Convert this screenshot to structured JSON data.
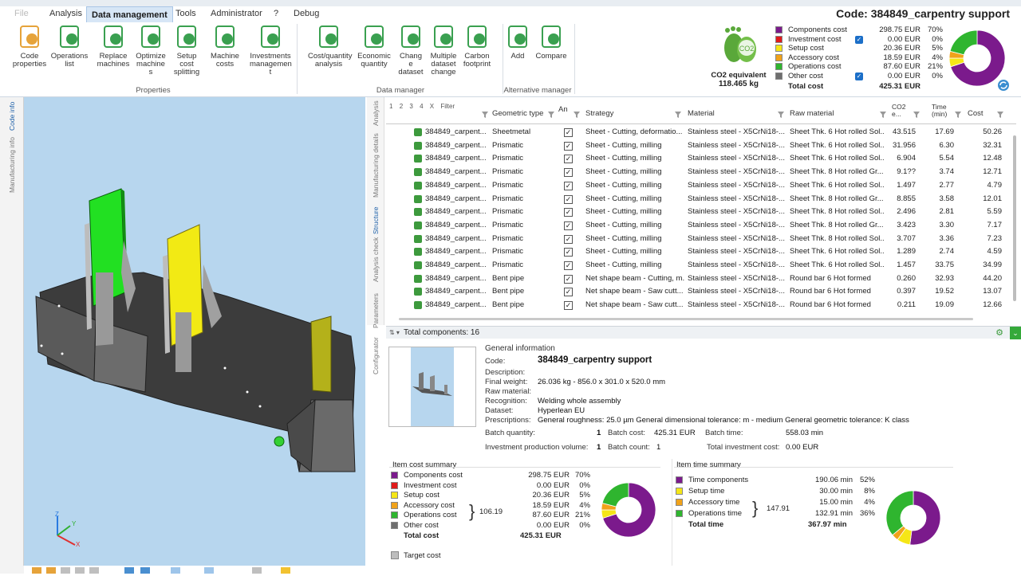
{
  "window": {
    "title": "Code: 384849_carpentry support",
    "file_tab": "File"
  },
  "menu": [
    "Analysis",
    "Data management",
    "Tools",
    "Administrator",
    "?",
    "Debug"
  ],
  "ribbon": {
    "buttons": [
      {
        "label": "Code\nproperties",
        "icon": "code-properties-icon"
      },
      {
        "label": "Operations\nlist",
        "icon": "operations-list-icon"
      },
      {
        "label": "Replace\nmachines",
        "icon": "replace-machines-icon"
      },
      {
        "label": "Optimize\nmachine\ns",
        "icon": "optimize-machines-icon"
      },
      {
        "label": "Setup\ncost\nsplitting",
        "icon": "setup-cost-icon"
      },
      {
        "label": "Machine\ncosts",
        "icon": "machine-costs-icon"
      },
      {
        "label": "Investments\nmanagemen\nt",
        "icon": "investments-icon"
      },
      {
        "label": "Cost/quantity\nanalysis",
        "icon": "cost-quantity-icon"
      },
      {
        "label": "Economic\nquantity",
        "icon": "economic-quantity-icon"
      },
      {
        "label": "Chang\ne\ndataset",
        "icon": "change-dataset-icon"
      },
      {
        "label": "Multiple\ndataset\nchange",
        "icon": "multiple-dataset-icon"
      },
      {
        "label": "Carbon\nfootprint",
        "icon": "carbon-footprint-icon"
      },
      {
        "label": "Add",
        "icon": "add-icon"
      },
      {
        "label": "Compare",
        "icon": "compare-icon"
      }
    ],
    "groups": [
      "Properties",
      "Data manager",
      "Alternative manager"
    ]
  },
  "co2": {
    "label": "CO2 equivalent",
    "value": "118.465 kg"
  },
  "cost_legend": [
    {
      "name": "Components cost",
      "value": "298.75 EUR",
      "pct": "70%",
      "color": "#7b1a8c",
      "checked": false
    },
    {
      "name": "Investment cost",
      "value": "0.00 EUR",
      "pct": "0%",
      "color": "#e01b1b",
      "checked": true
    },
    {
      "name": "Setup cost",
      "value": "20.36 EUR",
      "pct": "5%",
      "color": "#f5e617",
      "checked": false
    },
    {
      "name": "Accessory cost",
      "value": "18.59 EUR",
      "pct": "4%",
      "color": "#f0a21a",
      "checked": false
    },
    {
      "name": "Operations cost",
      "value": "87.60 EUR",
      "pct": "21%",
      "color": "#2fb52f",
      "checked": false
    },
    {
      "name": "Other cost",
      "value": "0.00 EUR",
      "pct": "0%",
      "color": "#6e6e6e",
      "checked": true
    }
  ],
  "total_cost": {
    "label": "Total cost",
    "value": "425.31 EUR"
  },
  "side_tabs": [
    "Code info",
    "Manufacturing info"
  ],
  "mid_tabs": [
    "Analysis",
    "Manufacturing details",
    "Structure",
    "Analysis check",
    "Parameters",
    "Configurator"
  ],
  "grid": {
    "filter_label": "Filter",
    "level_buttons": [
      "1",
      "2",
      "3",
      "4",
      "X"
    ],
    "columns": [
      "Geometric type",
      "An",
      "Strategy",
      "Material",
      "Raw material",
      "CO2\ne...",
      "Time\n(min)",
      "Cost"
    ],
    "rows": [
      [
        "384849_carpent...",
        "Sheetmetal",
        "Sheet - Cutting, deformatio...",
        "Stainless steel - X5CrNi18-...",
        "Sheet Thk. 6 Hot rolled Sol...",
        "43.515",
        "17.69",
        "50.26"
      ],
      [
        "384849_carpent...",
        "Prismatic",
        "Sheet - Cutting, milling",
        "Stainless steel - X5CrNi18-...",
        "Sheet Thk. 6 Hot rolled Sol...",
        "31.956",
        "6.30",
        "32.31"
      ],
      [
        "384849_carpent...",
        "Prismatic",
        "Sheet - Cutting, milling",
        "Stainless steel - X5CrNi18-...",
        "Sheet Thk. 6 Hot rolled Sol...",
        "6.904",
        "5.54",
        "12.48"
      ],
      [
        "384849_carpent...",
        "Prismatic",
        "Sheet - Cutting, milling",
        "Stainless steel - X5CrNi18-...",
        "Sheet Thk. 8 Hot rolled Gr...",
        "9.1??",
        "3.74",
        "12.71"
      ],
      [
        "384849_carpent...",
        "Prismatic",
        "Sheet - Cutting, milling",
        "Stainless steel - X5CrNi18-...",
        "Sheet Thk. 6 Hot rolled Sol...",
        "1.497",
        "2.77",
        "4.79"
      ],
      [
        "384849_carpent...",
        "Prismatic",
        "Sheet - Cutting, milling",
        "Stainless steel - X5CrNi18-...",
        "Sheet Thk. 8 Hot rolled Gr...",
        "8.855",
        "3.58",
        "12.01"
      ],
      [
        "384849_carpent...",
        "Prismatic",
        "Sheet - Cutting, milling",
        "Stainless steel - X5CrNi18-...",
        "Sheet Thk. 8 Hot rolled Sol...",
        "2.496",
        "2.81",
        "5.59"
      ],
      [
        "384849_carpent...",
        "Prismatic",
        "Sheet - Cutting, milling",
        "Stainless steel - X5CrNi18-...",
        "Sheet Thk. 8 Hot rolled Gr...",
        "3.423",
        "3.30",
        "7.17"
      ],
      [
        "384849_carpent...",
        "Prismatic",
        "Sheet - Cutting, milling",
        "Stainless steel - X5CrNi18-...",
        "Sheet Thk. 8 Hot rolled Sol...",
        "3.707",
        "3.36",
        "7.23"
      ],
      [
        "384849_carpent...",
        "Prismatic",
        "Sheet - Cutting, milling",
        "Stainless steel - X5CrNi18-...",
        "Sheet Thk. 6 Hot rolled Sol...",
        "1.289",
        "2.74",
        "4.59"
      ],
      [
        "384849_carpent...",
        "Prismatic",
        "Sheet - Cutting, milling",
        "Stainless steel - X5CrNi18-...",
        "Sheet Thk. 6 Hot rolled Sol...",
        "1.457",
        "33.75",
        "34.99"
      ],
      [
        "384849_carpent...",
        "Bent pipe",
        "Net shape beam - Cutting, m...",
        "Stainless steel - X5CrNi18-...",
        "Round bar 6 Hot formed",
        "0.260",
        "32.93",
        "44.20"
      ],
      [
        "384849_carpent...",
        "Bent pipe",
        "Net shape beam - Saw cutt...",
        "Stainless steel - X5CrNi18-...",
        "Round bar 6 Hot formed",
        "0.397",
        "19.52",
        "13.07"
      ],
      [
        "384849_carpent...",
        "Bent pipe",
        "Net shape beam - Saw cutt...",
        "Stainless steel - X5CrNi18-...",
        "Round bar 6 Hot formed",
        "0.211",
        "19.09",
        "12.66"
      ]
    ]
  },
  "total_components": "Total components: 16",
  "general": {
    "heading": "General information",
    "fields": [
      {
        "label": "Code:",
        "value": "384849_carpentry support"
      },
      {
        "label": "Description:",
        "value": ""
      },
      {
        "label": "Final weight:",
        "value": "26.036 kg - 856.0 x 301.0 x 520.0 mm"
      },
      {
        "label": "Raw material:",
        "value": ""
      },
      {
        "label": "Recognition:",
        "value": "Welding whole assembly"
      },
      {
        "label": "Dataset:",
        "value": "Hyperlean EU"
      },
      {
        "label": "Prescriptions:",
        "value": "General roughness: 25.0 µm General dimensional tolerance: m - medium General geometric tolerance: K class"
      }
    ],
    "batch_quantity_label": "Batch quantity:",
    "batch_quantity": "1",
    "batch_cost_label": "Batch cost:",
    "batch_cost": "425.31 EUR",
    "batch_time_label": "Batch time:",
    "batch_time": "558.03 min",
    "investment_volume_label": "Investment production volume:",
    "investment_volume": "1",
    "batch_count_label": "Batch count:",
    "batch_count": "1",
    "total_investment_label": "Total investment cost:",
    "total_investment": "0.00 EUR"
  },
  "item_cost_summary": {
    "title": "Item cost summary",
    "rows": [
      {
        "name": "Components cost",
        "value": "298.75 EUR",
        "pct": "70%",
        "color": "#7b1a8c"
      },
      {
        "name": "Investment cost",
        "value": "0.00 EUR",
        "pct": "0%",
        "color": "#e01b1b"
      },
      {
        "name": "Setup cost",
        "value": "20.36 EUR",
        "pct": "5%",
        "color": "#f5e617"
      },
      {
        "name": "Accessory cost",
        "value": "18.59 EUR",
        "pct": "4%",
        "color": "#f0a21a"
      },
      {
        "name": "Operations cost",
        "value": "87.60 EUR",
        "pct": "21%",
        "color": "#2fb52f"
      },
      {
        "name": "Other cost",
        "value": "0.00 EUR",
        "pct": "0%",
        "color": "#6e6e6e"
      }
    ],
    "brace_value": "106.19",
    "total_label": "Total cost",
    "total_value": "425.31 EUR",
    "target_label": "Target cost",
    "pie": [
      70,
      0,
      5,
      4,
      21,
      0
    ]
  },
  "item_time_summary": {
    "title": "Item time summary",
    "rows": [
      {
        "name": "Time components",
        "value": "190.06 min",
        "pct": "52%",
        "color": "#7b1a8c"
      },
      {
        "name": "Setup time",
        "value": "30.00 min",
        "pct": "8%",
        "color": "#f5e617"
      },
      {
        "name": "Accessory time",
        "value": "15.00 min",
        "pct": "4%",
        "color": "#f0a21a"
      },
      {
        "name": "Operations time",
        "value": "132.91 min",
        "pct": "36%",
        "color": "#2fb52f"
      }
    ],
    "brace_value": "147.91",
    "total_label": "Total time",
    "total_value": "367.97 min",
    "pie": [
      52,
      8,
      4,
      36
    ]
  }
}
